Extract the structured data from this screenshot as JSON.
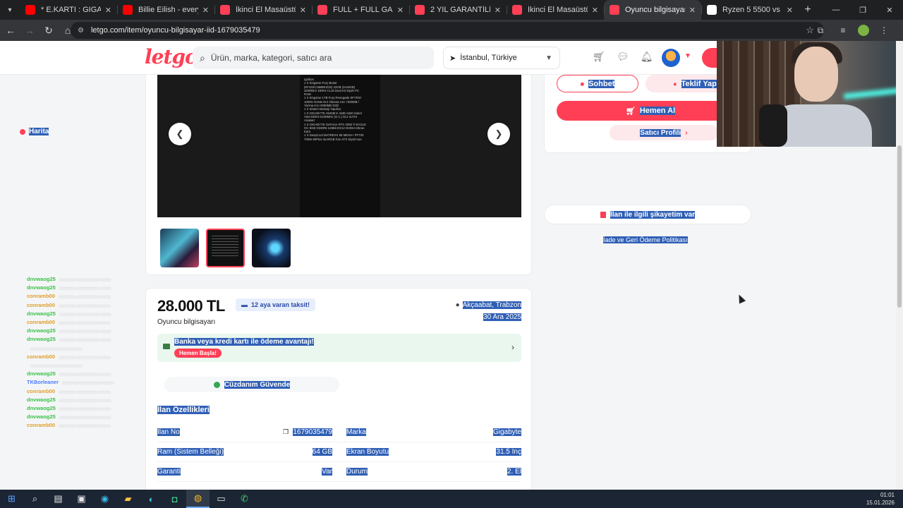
{
  "browser": {
    "tabs": [
      {
        "title": "* E.KARTI : GIGABYTE RTX",
        "favicon_color": "#ff0000",
        "active": false
      },
      {
        "title": "Billie Eilish - everything",
        "favicon_color": "#ff0000",
        "active": false
      },
      {
        "title": "İkinci El Masaüstü Bilgisay",
        "favicon_color": "#ff3f55",
        "active": false
      },
      {
        "title": "FULL + FULL GAMING PC",
        "favicon_color": "#ff3f55",
        "active": false
      },
      {
        "title": "2 YIL GARANTİLİ OYUNCU",
        "favicon_color": "#ff3f55",
        "active": false
      },
      {
        "title": "İkinci El Masaüstü Bilgisay",
        "favicon_color": "#ff3f55",
        "active": false
      },
      {
        "title": "Oyuncu bilgisayarı - Sıfır",
        "favicon_color": "#ff3f55",
        "active": true
      },
      {
        "title": "Ryzen 5 5500 vs i9 10900",
        "favicon_color": "#ffffff",
        "active": false
      }
    ],
    "url": "letgo.com/item/oyuncu-bilgisayar-iid-1679035479"
  },
  "header": {
    "logo": "letgo",
    "search_placeholder": "Ürün, marka, kategori, satıcı ara",
    "location": "İstanbul, Türkiye"
  },
  "listing": {
    "spec_screenshot_lines": [
      "Ignition",
      "1 X Kingston Fury Beast",
      "(KF432C16BBK2/32) 32GB (2x16GB)",
      "3200MHz DDR4 CL16 Dual Kit Siyah PC",
      "RAM",
      "1 X Kingston 1TB Fury Renegade SFYRS/",
      "1000G NVMe M.2 Okuma Hızı 7300MB /",
      "Yazma Hızı 6000MB SSD",
      "1 X Sistem Montajı Yapılsın",
      "1 X GIGABYTE A520M K AMD A520 Soket",
      "AM4 DDR4 5100MHz (O.C.) M.2 mATX",
      "Anakart",
      "1 X GIGABYTE GeForce RTX 4060 Ti EAGLE",
      "OC 8GB GDDR6 128Bit DX12 NVIDIA Ekran",
      "Kartı",
      "1 X DeepCool MATREXX 55 MESH+ PF700",
      "700W 80Plus 3xARGB Fan ATX Siyah Kas"
    ],
    "price": "28.000 TL",
    "installment_badge": "12 aya varan taksit!",
    "title": "Oyuncu bilgisayarı",
    "location": "Akçaabat, Trabzon",
    "date": "30 Ara 2025",
    "promo_text": "Banka veya kredi kartı ile ödeme avantajı!",
    "promo_button": "Hemen Başla!",
    "wallet_text": "Cüzdanım Güvende",
    "specs_title": "İlan Özellikleri",
    "specs": [
      {
        "label": "İlan No",
        "value": "1679035479",
        "label2": "Marka",
        "value2": "Gigabyte"
      },
      {
        "label": "Ram (Sistem Belleği)",
        "value": "64 GB",
        "label2": "Ekran Boyutu",
        "value2": "31.5 İnç"
      },
      {
        "label": "Garanti",
        "value": "Var",
        "label2": "Durum",
        "value2": "2. El"
      }
    ]
  },
  "actions": {
    "chat": "Sohbet",
    "offer": "Teklif Yap",
    "buy_now": "Hemen Al",
    "map": "Harita",
    "seller_profile": "Satıcı Profili",
    "complaint": "İlan ile ilgili şikayetim var",
    "refund_policy": "İade ve Geri Ödeme Politikası"
  },
  "chat_overlay": [
    {
      "user": "dnvwaog25",
      "color": "#3cc24a"
    },
    {
      "user": "dnvwaog25",
      "color": "#3cc24a"
    },
    {
      "user": "conramb00",
      "color": "#e0a02a"
    },
    {
      "user": "conramb00",
      "color": "#e0a02a"
    },
    {
      "user": "dnvwaog25",
      "color": "#3cc24a"
    },
    {
      "user": "conramb00",
      "color": "#e0a02a"
    },
    {
      "user": "dnvwaog25",
      "color": "#3cc24a"
    },
    {
      "user": "dnvwaog25",
      "color": "#3cc24a"
    },
    {
      "user": "",
      "color": "#3cc24a"
    },
    {
      "user": "conramb00",
      "color": "#e0a02a"
    },
    {
      "user": "",
      "color": "#e0a02a"
    },
    {
      "user": "dnvwaog25",
      "color": "#3cc24a"
    },
    {
      "user": "TKBorleaner",
      "color": "#4a7cff"
    },
    {
      "user": "conramb00",
      "color": "#e0a02a"
    },
    {
      "user": "dnvwaog25",
      "color": "#3cc24a"
    },
    {
      "user": "dnvwaog25",
      "color": "#3cc24a"
    },
    {
      "user": "dnvwaog25",
      "color": "#3cc24a"
    },
    {
      "user": "conramb00",
      "color": "#e0a02a"
    }
  ],
  "taskbar": {
    "time": "01:01",
    "date": "15.01.2026"
  },
  "colors": {
    "brand": "#ff3f55",
    "selection": "#2f5fb5"
  }
}
